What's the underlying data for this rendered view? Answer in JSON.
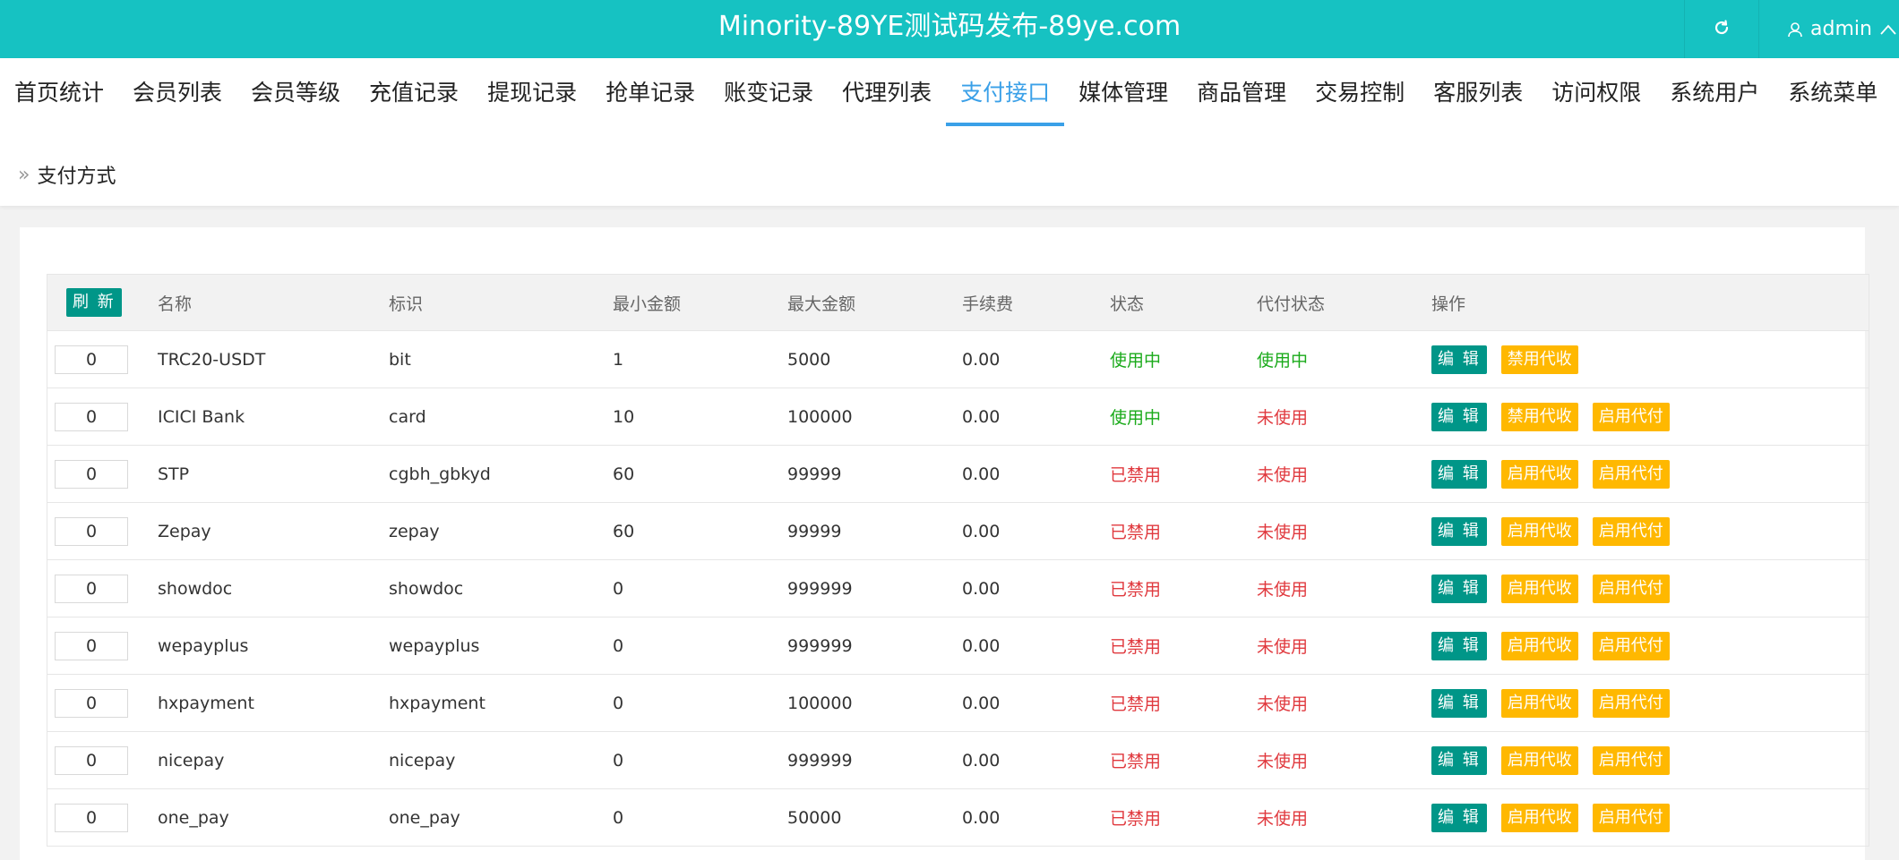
{
  "header": {
    "title": "Minority-89YE测试码发布-89ye.com",
    "user": "admin"
  },
  "nav": {
    "tabs": [
      {
        "label": "首页统计",
        "active": false
      },
      {
        "label": "会员列表",
        "active": false
      },
      {
        "label": "会员等级",
        "active": false
      },
      {
        "label": "充值记录",
        "active": false
      },
      {
        "label": "提现记录",
        "active": false
      },
      {
        "label": "抢单记录",
        "active": false
      },
      {
        "label": "账变记录",
        "active": false
      },
      {
        "label": "代理列表",
        "active": false
      },
      {
        "label": "支付接口",
        "active": true
      },
      {
        "label": "媒体管理",
        "active": false
      },
      {
        "label": "商品管理",
        "active": false
      },
      {
        "label": "交易控制",
        "active": false
      },
      {
        "label": "客服列表",
        "active": false
      },
      {
        "label": "访问权限",
        "active": false
      },
      {
        "label": "系统用户",
        "active": false
      },
      {
        "label": "系统菜单",
        "active": false
      }
    ]
  },
  "breadcrumb": {
    "label": "支付方式"
  },
  "table": {
    "refresh_label": "刷 新",
    "columns": {
      "name": "名称",
      "code": "标识",
      "min": "最小金额",
      "max": "最大金额",
      "fee": "手续费",
      "status": "状态",
      "payout_status": "代付状态",
      "ops": "操作"
    },
    "rows": [
      {
        "sort": "0",
        "name": "TRC20-USDT",
        "code": "bit",
        "min": "1",
        "max": "5000",
        "fee": "0.00",
        "status": "使用中",
        "status_ok": true,
        "payout": "使用中",
        "payout_ok": true,
        "actions": [
          "编 辑",
          "禁用代收"
        ]
      },
      {
        "sort": "0",
        "name": "ICICI Bank",
        "code": "card",
        "min": "10",
        "max": "100000",
        "fee": "0.00",
        "status": "使用中",
        "status_ok": true,
        "payout": "未使用",
        "payout_ok": false,
        "actions": [
          "编 辑",
          "禁用代收",
          "启用代付"
        ]
      },
      {
        "sort": "0",
        "name": "STP",
        "code": "cgbh_gbkyd",
        "min": "60",
        "max": "99999",
        "fee": "0.00",
        "status": "已禁用",
        "status_ok": false,
        "payout": "未使用",
        "payout_ok": false,
        "actions": [
          "编 辑",
          "启用代收",
          "启用代付"
        ]
      },
      {
        "sort": "0",
        "name": "Zepay",
        "code": "zepay",
        "min": "60",
        "max": "99999",
        "fee": "0.00",
        "status": "已禁用",
        "status_ok": false,
        "payout": "未使用",
        "payout_ok": false,
        "actions": [
          "编 辑",
          "启用代收",
          "启用代付"
        ]
      },
      {
        "sort": "0",
        "name": "showdoc",
        "code": "showdoc",
        "min": "0",
        "max": "999999",
        "fee": "0.00",
        "status": "已禁用",
        "status_ok": false,
        "payout": "未使用",
        "payout_ok": false,
        "actions": [
          "编 辑",
          "启用代收",
          "启用代付"
        ]
      },
      {
        "sort": "0",
        "name": "wepayplus",
        "code": "wepayplus",
        "min": "0",
        "max": "999999",
        "fee": "0.00",
        "status": "已禁用",
        "status_ok": false,
        "payout": "未使用",
        "payout_ok": false,
        "actions": [
          "编 辑",
          "启用代收",
          "启用代付"
        ]
      },
      {
        "sort": "0",
        "name": "hxpayment",
        "code": "hxpayment",
        "min": "0",
        "max": "100000",
        "fee": "0.00",
        "status": "已禁用",
        "status_ok": false,
        "payout": "未使用",
        "payout_ok": false,
        "actions": [
          "编 辑",
          "启用代收",
          "启用代付"
        ]
      },
      {
        "sort": "0",
        "name": "nicepay",
        "code": "nicepay",
        "min": "0",
        "max": "999999",
        "fee": "0.00",
        "status": "已禁用",
        "status_ok": false,
        "payout": "未使用",
        "payout_ok": false,
        "actions": [
          "编 辑",
          "启用代收",
          "启用代付"
        ]
      },
      {
        "sort": "0",
        "name": "one_pay",
        "code": "one_pay",
        "min": "0",
        "max": "50000",
        "fee": "0.00",
        "status": "已禁用",
        "status_ok": false,
        "payout": "未使用",
        "payout_ok": false,
        "actions": [
          "编 辑",
          "启用代收",
          "启用代付"
        ]
      }
    ]
  },
  "colors": {
    "header_bg": "#16c2c2",
    "active_tab": "#3aa0e8",
    "primary_button": "#009688",
    "warn_button": "#ffb800",
    "status_ok": "#1aaa1a",
    "status_bad": "#e0393e"
  },
  "icons": {
    "refresh": "refresh-icon",
    "user": "user-icon",
    "caret": "chevron-up-icon",
    "breadcrumb": "double-chevron-right-icon"
  }
}
